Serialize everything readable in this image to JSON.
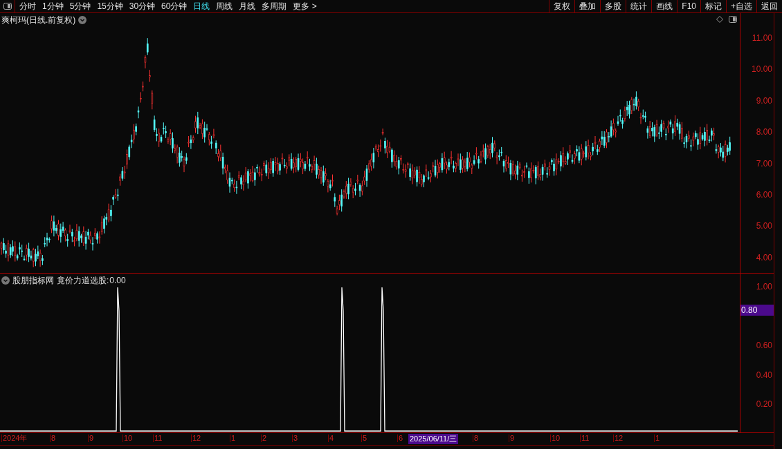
{
  "toolbar": {
    "periods": [
      {
        "label": "分时",
        "selected": false
      },
      {
        "label": "1分钟",
        "selected": false
      },
      {
        "label": "5分钟",
        "selected": false
      },
      {
        "label": "15分钟",
        "selected": false
      },
      {
        "label": "30分钟",
        "selected": false
      },
      {
        "label": "60分钟",
        "selected": false
      },
      {
        "label": "日线",
        "selected": true
      },
      {
        "label": "周线",
        "selected": false
      },
      {
        "label": "月线",
        "selected": false
      },
      {
        "label": "多周期",
        "selected": false
      }
    ],
    "more": "更多 >",
    "buttons": [
      "复权",
      "叠加",
      "多股",
      "统计",
      "画线",
      "F10",
      "标记",
      "+自选",
      "返回"
    ]
  },
  "main_chart": {
    "title": "爽柯玛(日线.前复权)",
    "y_labels": [
      "11.00",
      "10.00",
      "9.00",
      "8.00",
      "7.00",
      "6.00",
      "5.00",
      "4.00"
    ]
  },
  "indicator": {
    "name": "股朋指标网",
    "formula": "竟价力道选股:",
    "value": "0.00",
    "y_labels": [
      "1.00",
      "0.60",
      "0.40",
      "0.20"
    ]
  },
  "crosshair": {
    "value": "0.80",
    "date": "2025/06/11/三"
  },
  "x_axis": [
    "2024年",
    "8",
    "9",
    "10",
    "11",
    "12",
    "1",
    "2",
    "3",
    "4",
    "5",
    "6",
    "8",
    "9",
    "10",
    "11",
    "12",
    "1"
  ]
}
